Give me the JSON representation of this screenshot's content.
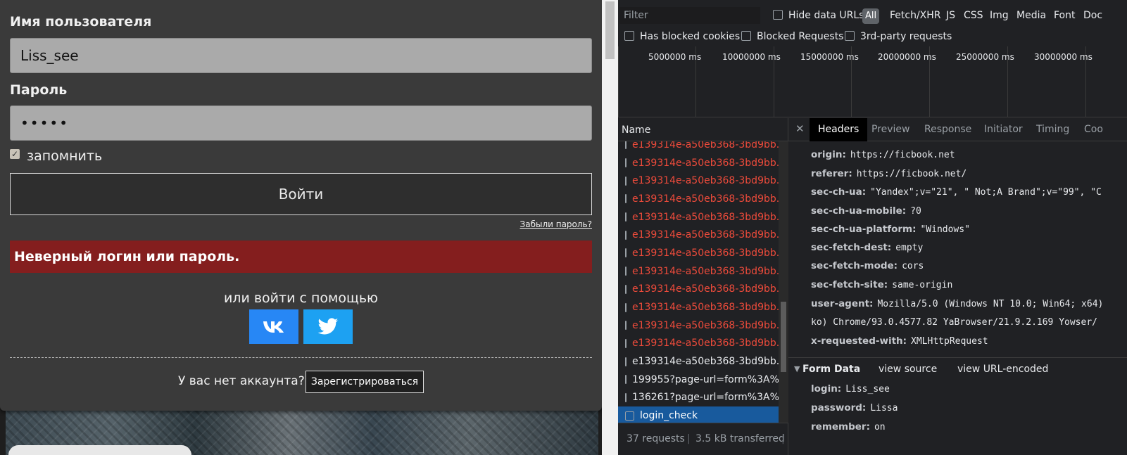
{
  "login_form": {
    "username_label": "Имя пользователя",
    "username_value": "Liss_see",
    "password_label": "Пароль",
    "password_value": "•••••",
    "remember_label": "запомнить",
    "remember_checked": true,
    "login_button": "Войти",
    "forgot_link": "Забыли пароль?",
    "error_message": "Неверный логин или пароль.",
    "social_title": "или войти с помощью",
    "no_account_text": "У вас нет аккаунта?",
    "register_button": "Зарегистрироваться"
  },
  "devtools": {
    "filter_placeholder": "Filter",
    "hide_data_urls": "Hide data URLs",
    "type_filters": [
      "All",
      "Fetch/XHR",
      "JS",
      "CSS",
      "Img",
      "Media",
      "Font",
      "Doc"
    ],
    "has_blocked_cookies": "Has blocked cookies",
    "blocked_requests": "Blocked Requests",
    "third_party": "3rd-party requests",
    "timeline_ticks": [
      "5000000 ms",
      "10000000 ms",
      "15000000 ms",
      "20000000 ms",
      "25000000 ms",
      "30000000 ms"
    ],
    "name_header": "Name",
    "requests": [
      {
        "name": "e139314e-a50eb368-3bd9bb...",
        "status": "error"
      },
      {
        "name": "e139314e-a50eb368-3bd9bb...",
        "status": "error"
      },
      {
        "name": "e139314e-a50eb368-3bd9bb...",
        "status": "error"
      },
      {
        "name": "e139314e-a50eb368-3bd9bb...",
        "status": "error"
      },
      {
        "name": "e139314e-a50eb368-3bd9bb...",
        "status": "error"
      },
      {
        "name": "e139314e-a50eb368-3bd9bb...",
        "status": "error"
      },
      {
        "name": "e139314e-a50eb368-3bd9bb...",
        "status": "error"
      },
      {
        "name": "e139314e-a50eb368-3bd9bb...",
        "status": "error"
      },
      {
        "name": "e139314e-a50eb368-3bd9bb...",
        "status": "error"
      },
      {
        "name": "e139314e-a50eb368-3bd9bb...",
        "status": "error"
      },
      {
        "name": "e139314e-a50eb368-3bd9bb...",
        "status": "error"
      },
      {
        "name": "e139314e-a50eb368-3bd9bb...",
        "status": "error"
      },
      {
        "name": "e139314e-a50eb368-3bd9bb...",
        "status": "ok"
      },
      {
        "name": "199955?page-url=form%3A%...",
        "status": "ok"
      },
      {
        "name": "136261?page-url=form%3A%...",
        "status": "ok"
      },
      {
        "name": "login_check",
        "status": "selected"
      }
    ],
    "status_requests": "37 requests",
    "status_transferred": "3.5 kB transferred",
    "detail_tabs": [
      "Headers",
      "Preview",
      "Response",
      "Initiator",
      "Timing",
      "Coo"
    ],
    "request_headers": [
      {
        "key": "origin:",
        "value": "https://ficbook.net"
      },
      {
        "key": "referer:",
        "value": "https://ficbook.net/"
      },
      {
        "key": "sec-ch-ua:",
        "value": "\"Yandex\";v=\"21\", \" Not;A Brand\";v=\"99\", \"C"
      },
      {
        "key": "sec-ch-ua-mobile:",
        "value": "?0"
      },
      {
        "key": "sec-ch-ua-platform:",
        "value": "\"Windows\""
      },
      {
        "key": "sec-fetch-dest:",
        "value": "empty"
      },
      {
        "key": "sec-fetch-mode:",
        "value": "cors"
      },
      {
        "key": "sec-fetch-site:",
        "value": "same-origin"
      },
      {
        "key": "user-agent:",
        "value": "Mozilla/5.0 (Windows NT 10.0; Win64; x64)"
      },
      {
        "key": "",
        "value": "ko) Chrome/93.0.4577.82 YaBrowser/21.9.2.169 Yowser/"
      },
      {
        "key": "x-requested-with:",
        "value": "XMLHttpRequest"
      }
    ],
    "form_data_title": "Form Data",
    "view_source": "view source",
    "view_url_encoded": "view URL-encoded",
    "form_data": [
      {
        "key": "login:",
        "value": "Liss_see"
      },
      {
        "key": "password:",
        "value": "Lissa"
      },
      {
        "key": "remember:",
        "value": "on"
      }
    ]
  },
  "colors": {
    "error_banner": "#841e1e",
    "vk": "#2787f5",
    "twitter": "#1da1f2",
    "request_error": "#ee4b3b",
    "selected_row": "#185a9d"
  }
}
